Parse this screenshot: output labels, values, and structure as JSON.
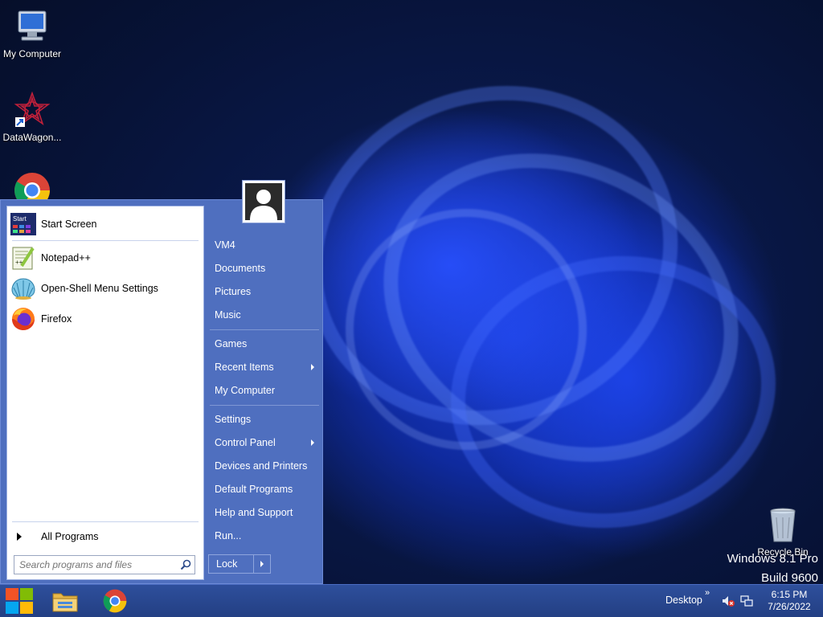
{
  "desktop": {
    "icons": [
      {
        "label": "My Computer",
        "icon": "computer-icon"
      },
      {
        "label": "DataWagon...",
        "icon": "datawagon-icon"
      },
      {
        "label": "",
        "icon": "chrome-icon"
      },
      {
        "label": "Recycle Bin",
        "icon": "recycle-bin-icon"
      }
    ],
    "watermark": {
      "line1": "Windows 8.1 Pro",
      "line2": "Build 9600"
    }
  },
  "start_menu": {
    "pinned": [
      {
        "label": "Start Screen",
        "icon": "start-screen-icon",
        "icon_text": "Start"
      }
    ],
    "recent": [
      {
        "label": "Notepad++",
        "icon": "notepadpp-icon"
      },
      {
        "label": "Open-Shell Menu Settings",
        "icon": "open-shell-icon"
      },
      {
        "label": "Firefox",
        "icon": "firefox-icon"
      }
    ],
    "all_programs_label": "All Programs",
    "search": {
      "placeholder": "Search programs and files",
      "value": ""
    },
    "right_items": {
      "group1": [
        {
          "label": "VM4"
        },
        {
          "label": "Documents"
        },
        {
          "label": "Pictures"
        },
        {
          "label": "Music"
        }
      ],
      "group2": [
        {
          "label": "Games"
        },
        {
          "label": "Recent Items",
          "has_submenu": true
        },
        {
          "label": "My Computer"
        }
      ],
      "group3": [
        {
          "label": "Settings"
        },
        {
          "label": "Control Panel",
          "has_submenu": true
        },
        {
          "label": "Devices and Printers"
        },
        {
          "label": "Default Programs"
        },
        {
          "label": "Help and Support"
        },
        {
          "label": "Run..."
        }
      ]
    },
    "shutdown_label": "Lock"
  },
  "taskbar": {
    "pinned": [
      {
        "icon": "start-button-icon"
      },
      {
        "icon": "file-explorer-icon"
      },
      {
        "icon": "chrome-icon"
      }
    ],
    "tray": {
      "desktop_label": "Desktop",
      "chevron": "»",
      "time": "6:15 PM",
      "date": "7/26/2022"
    }
  },
  "colors": {
    "menu_blue": "#4f6fbf",
    "taskbar_blue": "#2e4f9c"
  }
}
